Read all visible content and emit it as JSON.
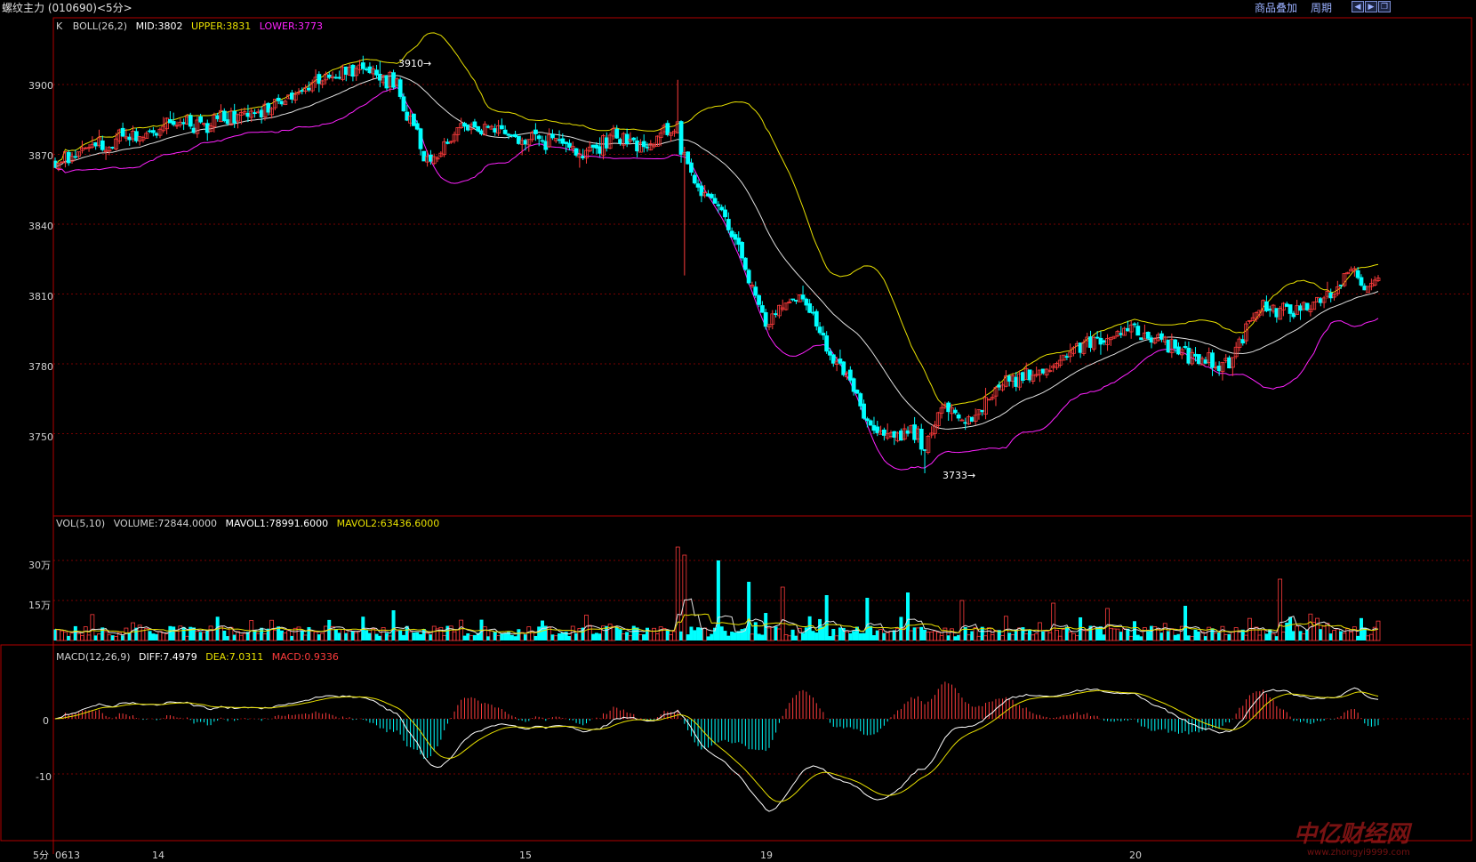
{
  "topbar": {
    "title": "螺纹主力 (010690)<5分>",
    "btn_overlay": "商品叠加",
    "btn_period": "周期",
    "win_buttons": [
      "◀",
      "▶",
      "❐"
    ]
  },
  "colors": {
    "up": "#ff3c3c",
    "down": "#00ffff",
    "mid": "#e0e0e0",
    "upper": "#e8e000",
    "lower": "#ff22ff",
    "dea": "#e8e000",
    "diff": "#ffffff",
    "frame": "#b00000",
    "grid": "#7a0000"
  },
  "main_panel": {
    "legend": [
      {
        "text": "K",
        "color": "#d0d0d0"
      },
      {
        "text": "BOLL(26,2)",
        "color": "#d0d0d0"
      },
      {
        "text": "MID:3802",
        "color": "#ffffff"
      },
      {
        "text": "UPPER:3831",
        "color": "#e8e000"
      },
      {
        "text": "LOWER:3773",
        "color": "#ff22ff"
      }
    ],
    "y_ticks": [
      "3900",
      "3870",
      "3840",
      "3810",
      "3780",
      "3750"
    ],
    "annotations": [
      {
        "text": "3910→",
        "value": 3910
      },
      {
        "text": "3733→",
        "value": 3733
      }
    ]
  },
  "vol_panel": {
    "legend": [
      {
        "text": "VOL(5,10)",
        "color": "#d0d0d0"
      },
      {
        "text": "VOLUME:72844.0000",
        "color": "#d0d0d0"
      },
      {
        "text": "MAVOL1:78991.6000",
        "color": "#ffffff"
      },
      {
        "text": "MAVOL2:63436.6000",
        "color": "#e8e000"
      }
    ],
    "y_ticks": [
      "30万",
      "15万"
    ]
  },
  "macd_panel": {
    "legend": [
      {
        "text": "MACD(12,26,9)",
        "color": "#d0d0d0"
      },
      {
        "text": "DIFF:7.4979",
        "color": "#ffffff"
      },
      {
        "text": "DEA:7.0311",
        "color": "#e8e000"
      },
      {
        "text": "MACD:0.9336",
        "color": "#ff3c3c"
      }
    ],
    "y_ticks": [
      "0",
      "-10"
    ]
  },
  "x_axis": {
    "period_label": "5分",
    "labels": [
      "0613",
      "14",
      "15",
      "19",
      "20"
    ]
  },
  "watermark": {
    "logo": "中亿财经网",
    "url": "www.zhongyi9999.com"
  },
  "chart_data": {
    "type": "candlestick",
    "symbol": "螺纹主力 (010690)",
    "period": "5分",
    "y_range_main": [
      3724,
      3930
    ],
    "y_range_vol": [
      0,
      400000
    ],
    "y_range_macd": [
      -25,
      17
    ],
    "keypoints_price": [
      [
        0,
        3867
      ],
      [
        10,
        3872
      ],
      [
        22,
        3878
      ],
      [
        35,
        3882
      ],
      [
        45,
        3883
      ],
      [
        50,
        3887
      ],
      [
        60,
        3887
      ],
      [
        70,
        3895
      ],
      [
        80,
        3902
      ],
      [
        88,
        3906
      ],
      [
        95,
        3905
      ],
      [
        101,
        3899
      ],
      [
        106,
        3880
      ],
      [
        110,
        3867
      ],
      [
        115,
        3872
      ],
      [
        120,
        3882
      ],
      [
        130,
        3880
      ],
      [
        140,
        3877
      ],
      [
        150,
        3875
      ],
      [
        155,
        3868
      ],
      [
        160,
        3872
      ],
      [
        165,
        3878
      ],
      [
        170,
        3875
      ],
      [
        177,
        3875
      ],
      [
        182,
        3880
      ],
      [
        184,
        3888
      ],
      [
        186,
        3872
      ],
      [
        190,
        3855
      ],
      [
        195,
        3850
      ],
      [
        200,
        3838
      ],
      [
        205,
        3815
      ],
      [
        210,
        3797
      ],
      [
        215,
        3806
      ],
      [
        220,
        3808
      ],
      [
        225,
        3797
      ],
      [
        230,
        3780
      ],
      [
        235,
        3773
      ],
      [
        240,
        3755
      ],
      [
        245,
        3748
      ],
      [
        250,
        3748
      ],
      [
        255,
        3751
      ],
      [
        257,
        3743
      ],
      [
        260,
        3754
      ],
      [
        263,
        3762
      ],
      [
        267,
        3758
      ],
      [
        271,
        3754
      ],
      [
        275,
        3762
      ],
      [
        282,
        3773
      ],
      [
        290,
        3775
      ],
      [
        300,
        3786
      ],
      [
        310,
        3791
      ],
      [
        318,
        3795
      ],
      [
        325,
        3791
      ],
      [
        335,
        3783
      ],
      [
        340,
        3783
      ],
      [
        344,
        3778
      ],
      [
        348,
        3783
      ],
      [
        352,
        3795
      ],
      [
        355,
        3804
      ],
      [
        362,
        3804
      ],
      [
        368,
        3802
      ],
      [
        372,
        3806
      ],
      [
        378,
        3810
      ],
      [
        382,
        3820
      ],
      [
        388,
        3815
      ]
    ],
    "annotated_high": 3910,
    "annotated_low": 3733,
    "boll": {
      "n": 26,
      "k": 2,
      "mid": 3802,
      "upper": 3831,
      "lower": 3773
    },
    "volume": {
      "last": 72844,
      "mavol1": 78991.6,
      "mavol2": 63436.6,
      "spikes": [
        [
          184,
          350000
        ],
        [
          186,
          320000
        ],
        [
          196,
          300000
        ],
        [
          205,
          220000
        ],
        [
          215,
          200000
        ],
        [
          228,
          170000
        ],
        [
          240,
          160000
        ],
        [
          252,
          180000
        ],
        [
          268,
          150000
        ],
        [
          295,
          140000
        ],
        [
          311,
          120000
        ],
        [
          334,
          130000
        ],
        [
          362,
          230000
        ]
      ]
    },
    "macd": {
      "fast": 12,
      "slow": 26,
      "signal": 9,
      "diff_last": 7.4979,
      "dea_last": 7.0311,
      "macd_last": 0.9336
    },
    "x_label_positions": [
      [
        "0613",
        0
      ],
      [
        "14",
        27
      ],
      [
        "15",
        127
      ],
      [
        "19",
        186
      ],
      [
        "20",
        292
      ]
    ],
    "gridlines": true
  }
}
